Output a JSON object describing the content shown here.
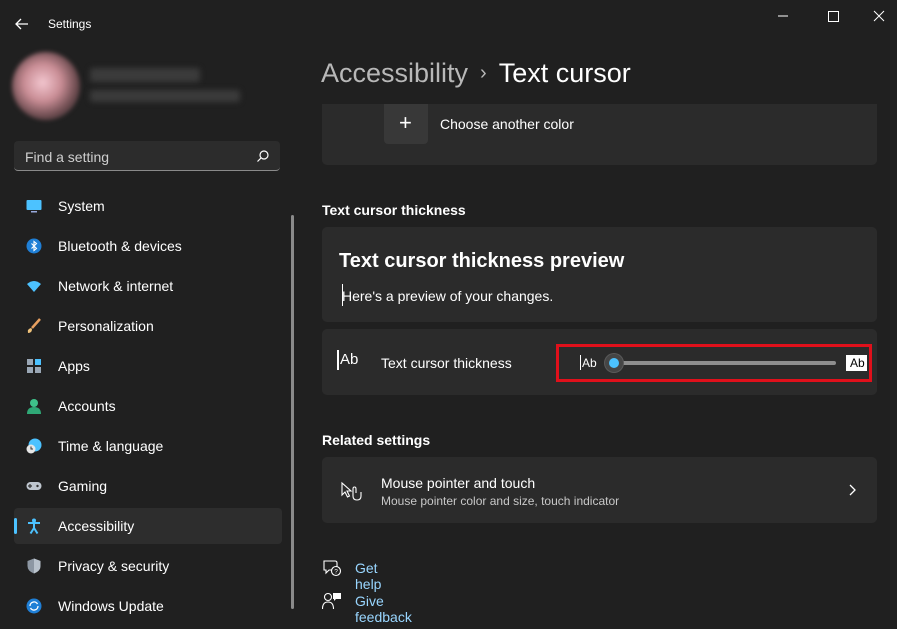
{
  "window": {
    "title": "Settings"
  },
  "search": {
    "placeholder": "Find a setting"
  },
  "nav": {
    "items": [
      {
        "label": "System",
        "icon": "system-icon"
      },
      {
        "label": "Bluetooth & devices",
        "icon": "bluetooth-icon"
      },
      {
        "label": "Network & internet",
        "icon": "wifi-icon"
      },
      {
        "label": "Personalization",
        "icon": "brush-icon"
      },
      {
        "label": "Apps",
        "icon": "apps-icon"
      },
      {
        "label": "Accounts",
        "icon": "accounts-icon"
      },
      {
        "label": "Time & language",
        "icon": "clock-globe-icon"
      },
      {
        "label": "Gaming",
        "icon": "gamepad-icon"
      },
      {
        "label": "Accessibility",
        "icon": "accessibility-icon",
        "selected": true
      },
      {
        "label": "Privacy & security",
        "icon": "shield-icon"
      },
      {
        "label": "Windows Update",
        "icon": "update-icon"
      }
    ]
  },
  "breadcrumb": {
    "parent": "Accessibility",
    "separator": "›",
    "current": "Text cursor"
  },
  "color_card": {
    "plus": "+",
    "label": "Choose another color"
  },
  "thickness_section": {
    "heading": "Text cursor thickness"
  },
  "preview": {
    "title": "Text cursor thickness preview",
    "text": "Here's a preview of your changes."
  },
  "thickness_setting": {
    "icon_text": "Ab",
    "label": "Text cursor thickness",
    "slider_min_label": "Ab",
    "slider_max_label": "Ab",
    "slider_value_fraction": 0.0
  },
  "related": {
    "heading": "Related settings",
    "mouse_title": "Mouse pointer and touch",
    "mouse_subtitle": "Mouse pointer color and size, touch indicator"
  },
  "links": {
    "help": "Get help",
    "feedback": "Give feedback"
  },
  "colors": {
    "accent": "#4cc2ff",
    "link": "#99d6ff",
    "highlight": "#e0101b",
    "background": "#202020",
    "card": "#2b2b2b"
  }
}
